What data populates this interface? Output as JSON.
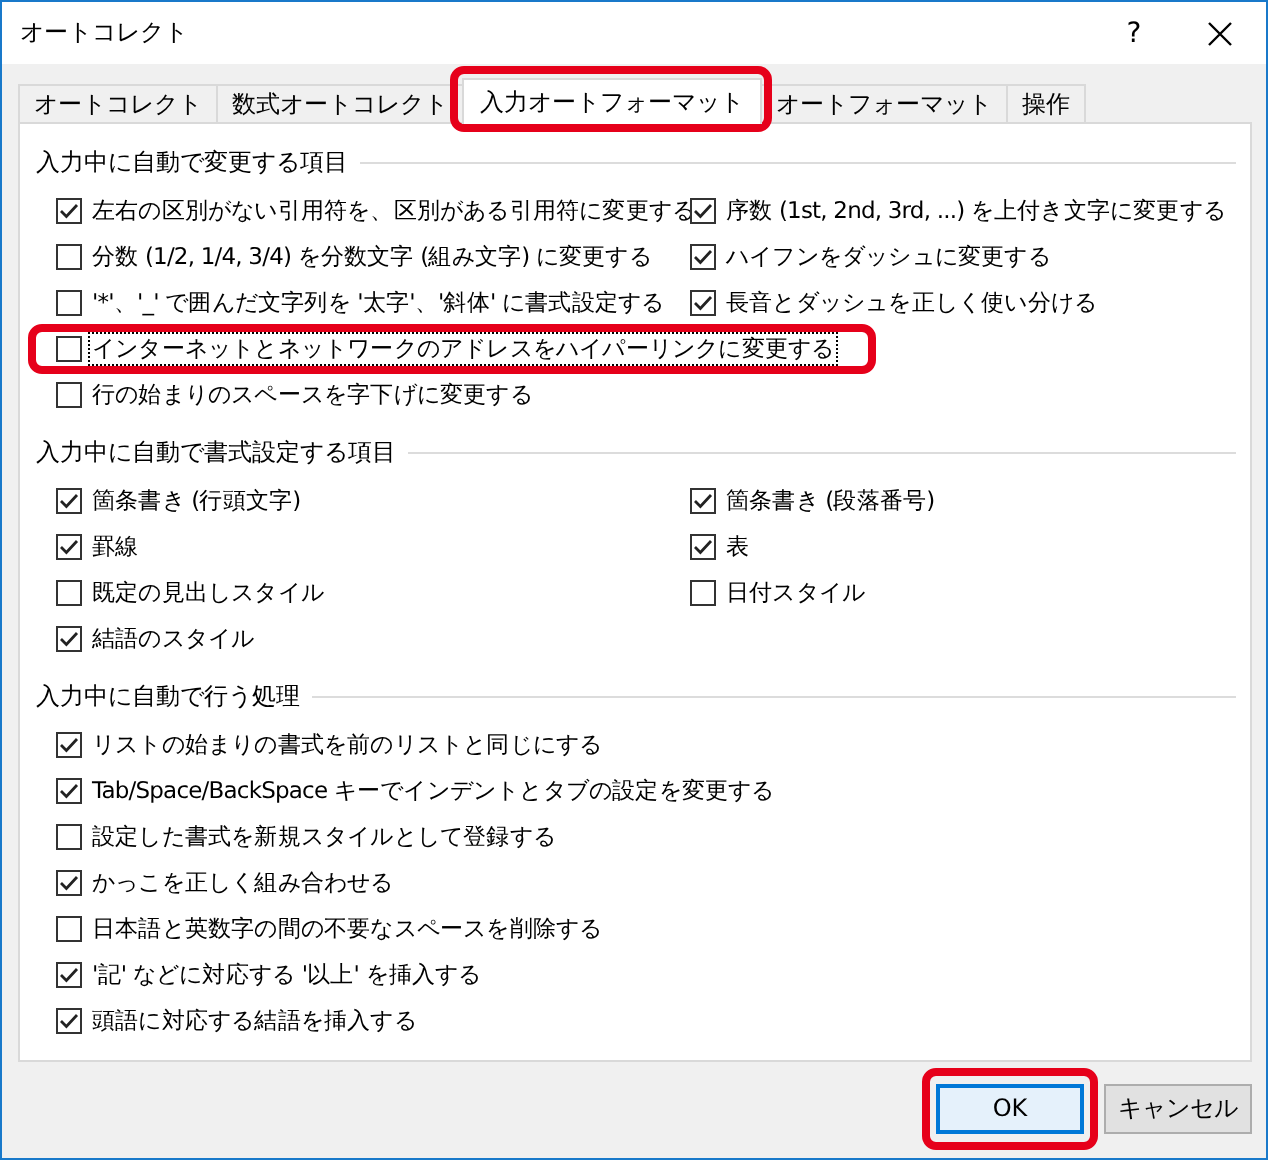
{
  "window": {
    "title": "オートコレクト",
    "help": "?"
  },
  "tabs": [
    {
      "label": "オートコレクト",
      "selected": false,
      "highlighted": false
    },
    {
      "label": "数式オートコレクト",
      "selected": false,
      "highlighted": false
    },
    {
      "label": "入力オートフォーマット",
      "selected": true,
      "highlighted": true
    },
    {
      "label": "オートフォーマット",
      "selected": false,
      "highlighted": false
    },
    {
      "label": "操作",
      "selected": false,
      "highlighted": false
    }
  ],
  "sections": [
    {
      "title": "入力中に自動で変更する項目",
      "rows": [
        [
          {
            "label": "左右の区別がない引用符を、区別がある引用符に変更する",
            "checked": true,
            "focused": false,
            "highlighted": false
          },
          {
            "label": "序数 (1st, 2nd, 3rd, ...) を上付き文字に変更する",
            "checked": true,
            "focused": false,
            "highlighted": false
          }
        ],
        [
          {
            "label": "分数 (1/2, 1/4, 3/4) を分数文字 (組み文字) に変更する",
            "checked": false,
            "focused": false,
            "highlighted": false
          },
          {
            "label": "ハイフンをダッシュに変更する",
            "checked": true,
            "focused": false,
            "highlighted": false
          }
        ],
        [
          {
            "label": "'*'、'_' で囲んだ文字列を '太字'、'斜体' に書式設定する",
            "checked": false,
            "focused": false,
            "highlighted": false
          },
          {
            "label": "長音とダッシュを正しく使い分ける",
            "checked": true,
            "focused": false,
            "highlighted": false
          }
        ],
        [
          {
            "label": "インターネットとネットワークのアドレスをハイパーリンクに変更する",
            "checked": false,
            "focused": true,
            "highlighted": true
          }
        ],
        [
          {
            "label": "行の始まりのスペースを字下げに変更する",
            "checked": false,
            "focused": false,
            "highlighted": false
          }
        ]
      ]
    },
    {
      "title": "入力中に自動で書式設定する項目",
      "rows": [
        [
          {
            "label": "箇条書き (行頭文字)",
            "checked": true,
            "focused": false,
            "highlighted": false
          },
          {
            "label": "箇条書き (段落番号)",
            "checked": true,
            "focused": false,
            "highlighted": false
          }
        ],
        [
          {
            "label": "罫線",
            "checked": true,
            "focused": false,
            "highlighted": false
          },
          {
            "label": "表",
            "checked": true,
            "focused": false,
            "highlighted": false
          }
        ],
        [
          {
            "label": "既定の見出しスタイル",
            "checked": false,
            "focused": false,
            "highlighted": false
          },
          {
            "label": "日付スタイル",
            "checked": false,
            "focused": false,
            "highlighted": false
          }
        ],
        [
          {
            "label": "結語のスタイル",
            "checked": true,
            "focused": false,
            "highlighted": false
          }
        ]
      ]
    },
    {
      "title": "入力中に自動で行う処理",
      "rows": [
        [
          {
            "label": "リストの始まりの書式を前のリストと同じにする",
            "checked": true,
            "focused": false,
            "highlighted": false
          }
        ],
        [
          {
            "label": "Tab/Space/BackSpace キーでインデントとタブの設定を変更する",
            "checked": true,
            "focused": false,
            "highlighted": false
          }
        ],
        [
          {
            "label": "設定した書式を新規スタイルとして登録する",
            "checked": false,
            "focused": false,
            "highlighted": false
          }
        ],
        [
          {
            "label": "かっこを正しく組み合わせる",
            "checked": true,
            "focused": false,
            "highlighted": false
          }
        ],
        [
          {
            "label": "日本語と英数字の間の不要なスペースを削除する",
            "checked": false,
            "focused": false,
            "highlighted": false
          }
        ],
        [
          {
            "label": "'記' などに対応する '以上' を挿入する",
            "checked": true,
            "focused": false,
            "highlighted": false
          }
        ],
        [
          {
            "label": "頭語に対応する結語を挿入する",
            "checked": true,
            "focused": false,
            "highlighted": false
          }
        ]
      ]
    }
  ],
  "buttons": [
    {
      "label": "OK",
      "default": true,
      "highlighted": true
    },
    {
      "label": "キャンセル",
      "default": false,
      "highlighted": false
    }
  ]
}
